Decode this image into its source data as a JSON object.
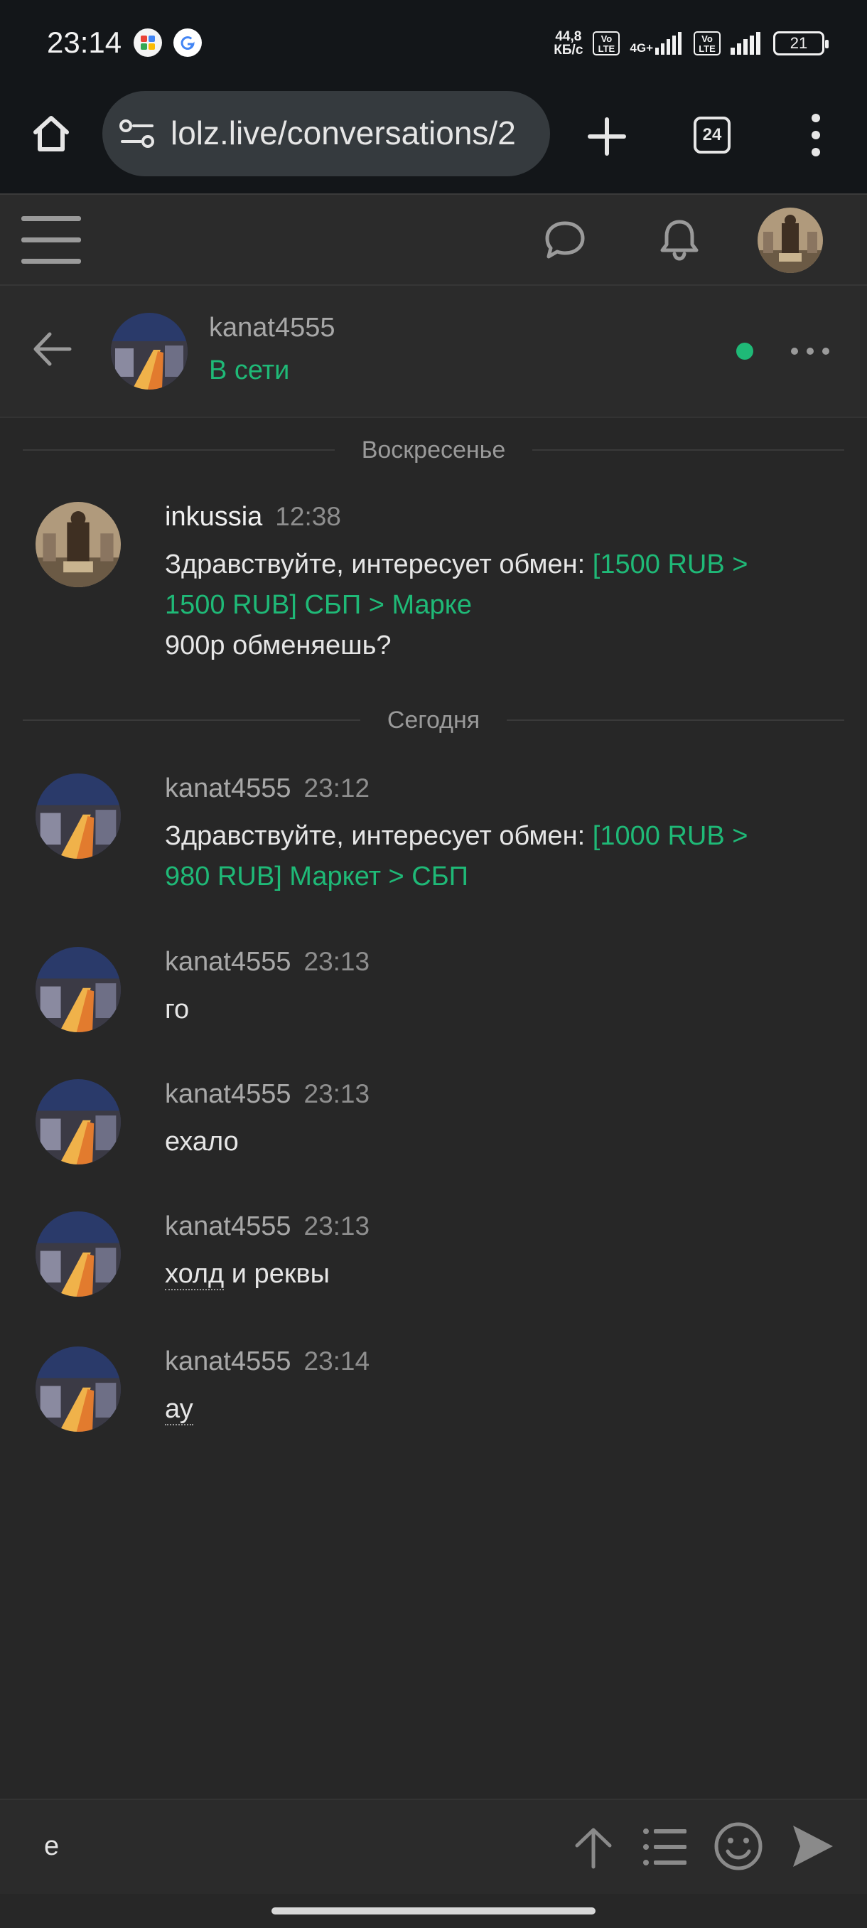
{
  "status_bar": {
    "time": "23:14",
    "net_speed_value": "44,8",
    "net_speed_unit": "КБ/с",
    "volte_label_1": "Vo LTE",
    "network_type": "4G+",
    "volte_label_2": "Vo LTE",
    "battery": "21"
  },
  "browser": {
    "url": "lolz.live/conversations/2",
    "tab_count": "24"
  },
  "conversation": {
    "username": "kanat4555",
    "status": "В сети"
  },
  "day_dividers": [
    "Воскресенье",
    "Сегодня"
  ],
  "messages": [
    {
      "author": "inkussia",
      "time": "12:38",
      "text": "Здравствуйте, интересует обмен: ",
      "link": "[1500 RUB > 1500 RUB] СБП > Марке",
      "extra": "900р обменяешь?"
    },
    {
      "author": "kanat4555",
      "time": "23:12",
      "text": "Здравствуйте, интересует обмен: ",
      "link": "[1000 RUB > 980 RUB] Маркет > СБП"
    },
    {
      "author": "kanat4555",
      "time": "23:13",
      "text": "го"
    },
    {
      "author": "kanat4555",
      "time": "23:13",
      "text": "ехало"
    },
    {
      "author": "kanat4555",
      "time": "23:13",
      "text_underlined": "холд",
      "text": " и реквы"
    },
    {
      "author": "kanat4555",
      "time": "23:14",
      "text_underlined": "ау"
    }
  ],
  "composer": {
    "value": "е"
  },
  "colors": {
    "accent_green": "#1fb977",
    "background": "#272727",
    "status_bar_bg": "#131619"
  }
}
